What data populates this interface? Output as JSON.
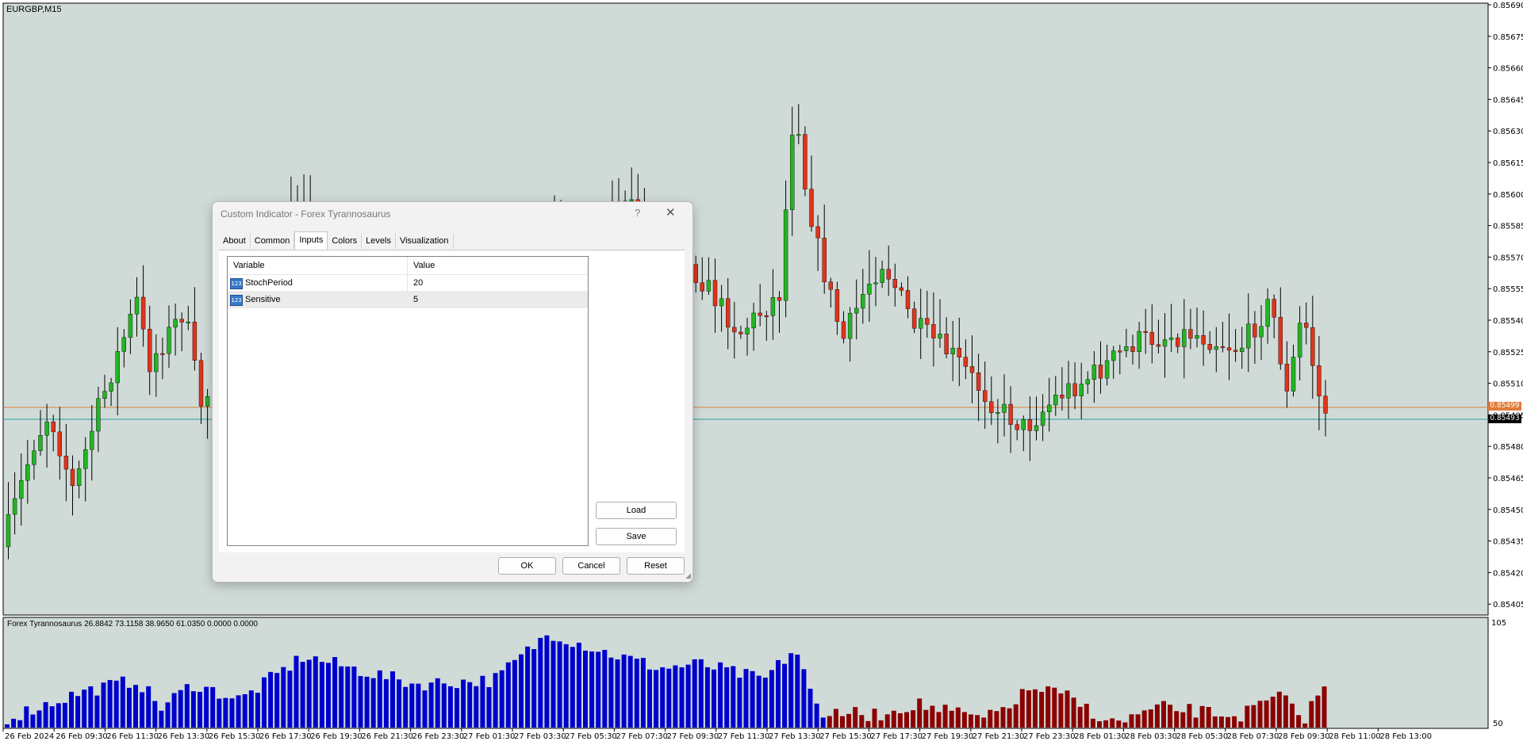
{
  "chart": {
    "symbol": "EURGBP,M15",
    "indicator_label": "Forex Tyrannosaurus 26.8842 73.1158 38.9650 61.0350 0.0000 0.0000",
    "price_labels": [
      "0.85690",
      "0.85675",
      "0.85660",
      "0.85645",
      "0.85630",
      "0.85615",
      "0.85600",
      "0.85585",
      "0.85570",
      "0.85555",
      "0.85540",
      "0.85525",
      "0.85510",
      "0.85495",
      "0.85480",
      "0.85465",
      "0.85450",
      "0.85435",
      "0.85420",
      "0.85405"
    ],
    "time_labels": [
      "26 Feb 2024",
      "26 Feb 09:30",
      "26 Feb 11:30",
      "26 Feb 13:30",
      "26 Feb 15:30",
      "26 Feb 17:30",
      "26 Feb 19:30",
      "26 Feb 21:30",
      "26 Feb 23:30",
      "27 Feb 01:30",
      "27 Feb 03:30",
      "27 Feb 05:30",
      "27 Feb 07:30",
      "27 Feb 09:30",
      "27 Feb 11:30",
      "27 Feb 13:30",
      "27 Feb 15:30",
      "27 Feb 17:30",
      "27 Feb 19:30",
      "27 Feb 21:30",
      "27 Feb 23:30",
      "28 Feb 01:30",
      "28 Feb 03:30",
      "28 Feb 05:30",
      "28 Feb 07:30",
      "28 Feb 09:30",
      "28 Feb 11:00",
      "28 Feb 13:00"
    ],
    "ind_levels": [
      "105",
      "50"
    ],
    "ask_tag": "0.85499",
    "bid_tag": "0.85493",
    "colors": {
      "background": "#d0dbd8",
      "bull": "#23b523",
      "bear": "#e0341c",
      "wick": "#000000",
      "hist_up": "#0000cc",
      "hist_down": "#8b0000",
      "ask_line": "#e07b39",
      "bid_line": "#2aa0a0"
    }
  },
  "dialog": {
    "title": "Custom Indicator - Forex Tyrannosaurus",
    "help": "?",
    "close": "✕",
    "tabs": [
      "About",
      "Common",
      "Inputs",
      "Colors",
      "Levels",
      "Visualization"
    ],
    "active_tab": "Inputs",
    "columns": {
      "variable": "Variable",
      "value": "Value"
    },
    "rows": [
      {
        "icon": "123",
        "name": "StochPeriod",
        "value": "20"
      },
      {
        "icon": "123",
        "name": "Sensitive",
        "value": "5"
      }
    ],
    "buttons": {
      "load": "Load",
      "save": "Save",
      "ok": "OK",
      "cancel": "Cancel",
      "reset": "Reset"
    }
  }
}
